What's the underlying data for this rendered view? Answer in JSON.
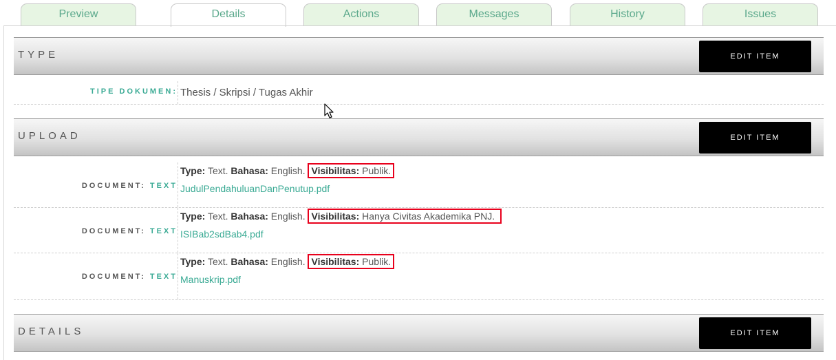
{
  "tabs": [
    {
      "label": "Preview"
    },
    {
      "label": "Details"
    },
    {
      "label": "Actions"
    },
    {
      "label": "Messages"
    },
    {
      "label": "History"
    },
    {
      "label": "Issues"
    }
  ],
  "active_tab": "Details",
  "edit_label": "EDIT ITEM",
  "sections": {
    "type": {
      "title": "TYPE",
      "row_label": "TIPE DOKUMEN:",
      "row_value": "Thesis / Skripsi / Tugas Akhir"
    },
    "upload": {
      "title": "UPLOAD",
      "label_prefix": "DOCUMENT:",
      "label_suffix": "TEXT",
      "meta_labels": {
        "type": "Type:",
        "bahasa": "Bahasa:",
        "visibilitas": "Visibilitas:"
      },
      "documents": [
        {
          "type": "Text.",
          "bahasa": "English.",
          "visibilitas": "Publik.",
          "file": "JudulPendahuluanDanPenutup.pdf"
        },
        {
          "type": "Text.",
          "bahasa": "English.",
          "visibilitas": "Hanya Civitas Akademika PNJ.",
          "file": "ISIBab2sdBab4.pdf"
        },
        {
          "type": "Text.",
          "bahasa": "English.",
          "visibilitas": "Publik.",
          "file": "Manuskrip.pdf"
        }
      ]
    },
    "details": {
      "title": "DETAILS"
    }
  },
  "colors": {
    "accent": "#3aaa94",
    "tab_bg": "#e7f5e3",
    "highlight": "#e8001c",
    "button_bg": "#000000"
  }
}
